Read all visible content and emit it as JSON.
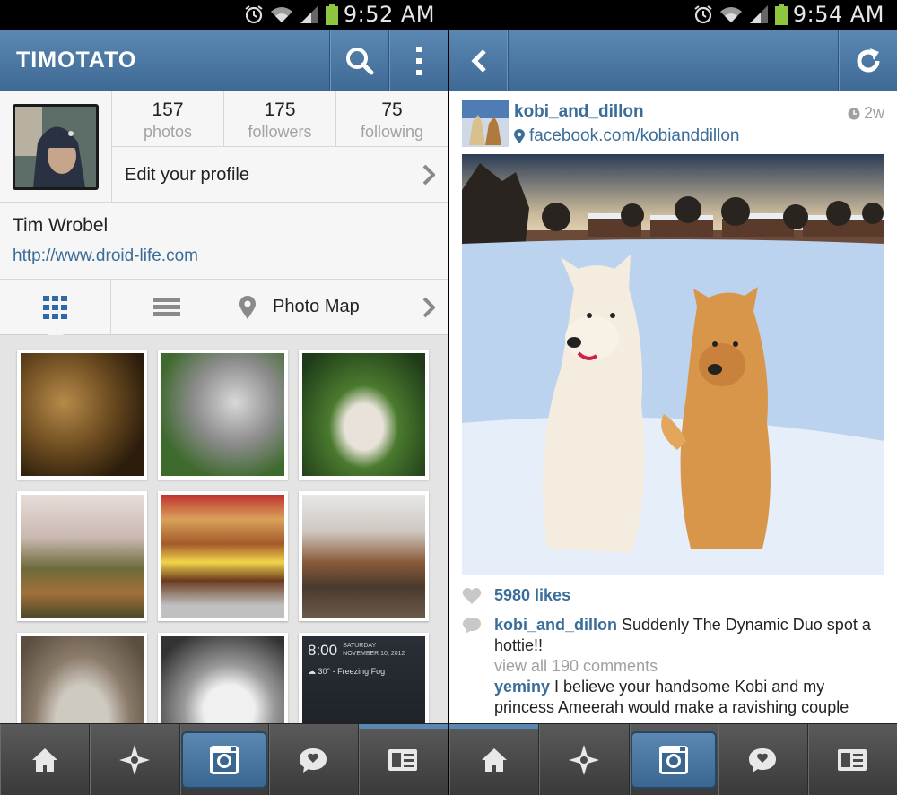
{
  "left": {
    "status_time": "9:52 AM",
    "header": {
      "title": "TIMOTATO"
    },
    "stats": [
      {
        "num": "157",
        "label": "photos"
      },
      {
        "num": "175",
        "label": "followers"
      },
      {
        "num": "75",
        "label": "following"
      }
    ],
    "edit_profile_label": "Edit your profile",
    "bio": {
      "name": "Tim Wrobel",
      "url": "http://www.droid-life.com"
    },
    "tabs": {
      "photo_map_label": "Photo Map"
    },
    "widget": {
      "time": "8:00",
      "day": "SATURDAY",
      "date": "NOVEMBER 10, 2012",
      "weather": "30° - Freezing Fog"
    }
  },
  "right": {
    "status_time": "9:54 AM",
    "post": {
      "username": "kobi_and_dillon",
      "location": "facebook.com/kobianddillon",
      "age": "2w",
      "likes": "5980 likes",
      "caption_user": "kobi_and_dillon",
      "caption_text": " Suddenly The Dynamic Duo spot a hottie!!",
      "view_all": "view all 190 comments",
      "comment_user": "yeminy",
      "comment_text": " I believe your handsome Kobi and my princess Ameerah would make a ravishing couple"
    }
  },
  "icons": {
    "nav": [
      "home-icon",
      "explore-icon",
      "camera-icon",
      "news-icon",
      "profile-icon"
    ],
    "accent": "#5b88b2"
  }
}
